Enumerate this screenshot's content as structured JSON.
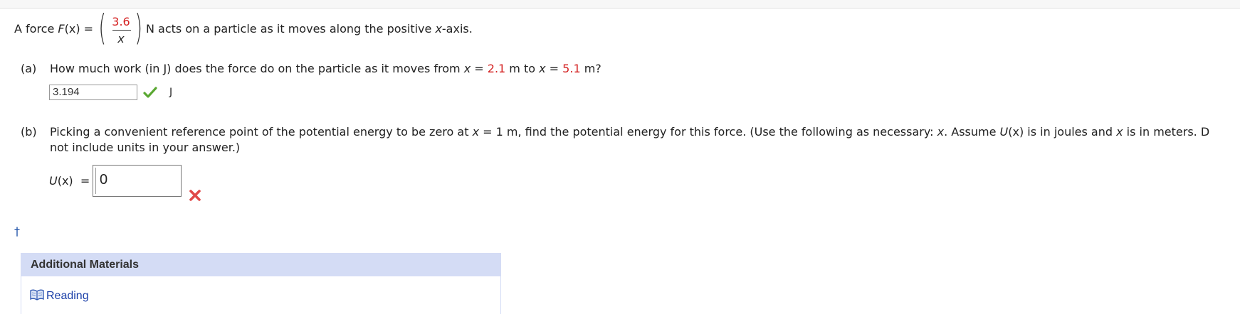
{
  "problem": {
    "intro_before": "A force ",
    "force_symbol": "F",
    "force_arg": "(x) =",
    "numerator": "3.6",
    "denominator": "x",
    "intro_after_prefix": "N acts on a particle as it moves along the positive ",
    "intro_after_var": "x",
    "intro_after_suffix": "-axis."
  },
  "part_a": {
    "label": "(a)",
    "q_prefix": "How much work (in J) does the force do on the particle as it moves from ",
    "x_var1": "x",
    "eq1": " = ",
    "x1_value": "2.1",
    "mid": " m to ",
    "x_var2": "x",
    "eq2": " = ",
    "x2_value": "5.1",
    "q_suffix": " m?",
    "answer_value": "3.194",
    "unit": "J",
    "status": "correct"
  },
  "part_b": {
    "label": "(b)",
    "line1_prefix": "Picking a convenient reference point of the potential energy to be zero at ",
    "line1_x": "x",
    "line1_mid": " = 1 m, find the potential energy for this force. (Use the following as necessary: ",
    "line1_x2": "x",
    "line1_mid2": ". Assume ",
    "line1_U": "U",
    "line1_mid3": "(x) is in joules and ",
    "line1_x3": "x",
    "line1_suffix": " is in meters. D",
    "line2": "not include units in your answer.)",
    "answer_label_U": "U",
    "answer_label_rest": "(x)  =",
    "answer_value": "0",
    "status": "incorrect"
  },
  "footnote_marker": "†",
  "materials": {
    "heading": "Additional Materials",
    "link_label": "Reading"
  },
  "colors": {
    "given_value": "#d42222",
    "correct": "#5aa832",
    "incorrect": "#e04848",
    "link": "#1b3fa8",
    "materials_header_bg": "#d4dcf5"
  },
  "icons": {
    "correct": "check-icon",
    "incorrect": "x-mark-icon",
    "reading": "book-icon"
  }
}
